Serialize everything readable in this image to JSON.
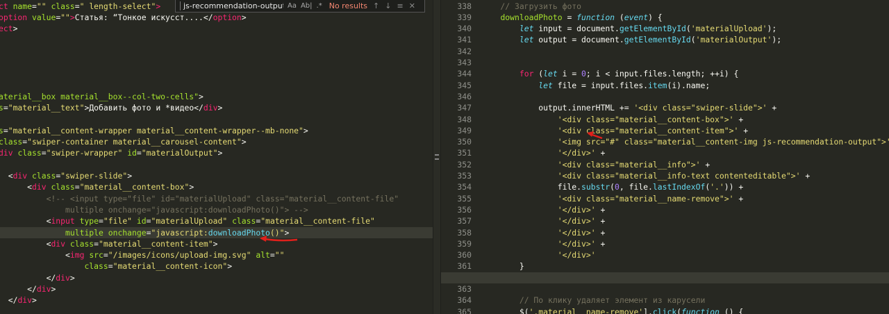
{
  "find_widget": {
    "query": "js-recommendation-output",
    "match_case": "Aa",
    "whole_word": "Ab|",
    "regex": ".*",
    "result": "No results",
    "prev": "↑",
    "next": "↓",
    "selection": "≡",
    "close": "✕"
  },
  "left_editor": {
    "lines": [
      [
        [
          "t",
          "ct "
        ],
        [
          "a",
          "name"
        ],
        [
          "w",
          "="
        ],
        [
          "s",
          "\"\""
        ],
        [
          "w",
          " "
        ],
        [
          "a",
          "class"
        ],
        [
          "w",
          "="
        ],
        [
          "s",
          "\" length-select\""
        ],
        [
          "t",
          ">"
        ]
      ],
      [
        [
          "t",
          "option "
        ],
        [
          "a",
          "value"
        ],
        [
          "w",
          "="
        ],
        [
          "s",
          "\"\""
        ],
        [
          "t",
          ">"
        ],
        [
          "w",
          "Статья: “Тонкое искусст....</"
        ],
        [
          "t",
          "option"
        ],
        [
          "w",
          ">"
        ]
      ],
      [
        [
          "t",
          "ect"
        ],
        [
          "w",
          ">"
        ]
      ],
      [],
      [],
      [],
      [],
      [],
      [
        [
          "a",
          "aterial__box material__box--col-two-cells\""
        ],
        [
          "w",
          ">"
        ]
      ],
      [
        [
          "a",
          "s"
        ],
        [
          "w",
          "="
        ],
        [
          "s",
          "\"material__text\""
        ],
        [
          "w",
          ">Добавить фото и *видео</"
        ],
        [
          "t",
          "div"
        ],
        [
          "w",
          ">"
        ]
      ],
      [],
      [
        [
          "a",
          "s"
        ],
        [
          "w",
          "="
        ],
        [
          "s",
          "\"material__content-wrapper material__content-wrapper--mb-none\""
        ],
        [
          "w",
          ">"
        ]
      ],
      [
        [
          "a",
          "class"
        ],
        [
          "w",
          "="
        ],
        [
          "s",
          "\"swiper-container material__carousel-content\""
        ],
        [
          "w",
          ">"
        ]
      ],
      [
        [
          "t",
          "div "
        ],
        [
          "a",
          "class"
        ],
        [
          "w",
          "="
        ],
        [
          "s",
          "\"swiper-wrapper\""
        ],
        [
          "w",
          " "
        ],
        [
          "a",
          "id"
        ],
        [
          "w",
          "="
        ],
        [
          "s",
          "\"materialOutput\""
        ],
        [
          "w",
          ">"
        ]
      ],
      [],
      [
        [
          "w",
          "  <"
        ],
        [
          "t",
          "div "
        ],
        [
          "a",
          "class"
        ],
        [
          "w",
          "="
        ],
        [
          "s",
          "\"swiper-slide\""
        ],
        [
          "w",
          ">"
        ]
      ],
      [
        [
          "w",
          "      <"
        ],
        [
          "t",
          "div "
        ],
        [
          "a",
          "class"
        ],
        [
          "w",
          "="
        ],
        [
          "s",
          "\"material__content-box\""
        ],
        [
          "w",
          ">"
        ]
      ],
      [
        [
          "c",
          "          <!-- <input type=\"file\" id=\"materialUpload\" class=\"material__content-file\""
        ]
      ],
      [
        [
          "c",
          "              multiple onchange=\"javascript:downloadPhoto()\"> -->"
        ]
      ],
      [
        [
          "w",
          "          <"
        ],
        [
          "t",
          "input "
        ],
        [
          "a",
          "type"
        ],
        [
          "w",
          "="
        ],
        [
          "s",
          "\"file\""
        ],
        [
          "w",
          " "
        ],
        [
          "a",
          "id"
        ],
        [
          "w",
          "="
        ],
        [
          "s",
          "\"materialUpload\""
        ],
        [
          "w",
          " "
        ],
        [
          "a",
          "class"
        ],
        [
          "w",
          "="
        ],
        [
          "s",
          "\"material__content-file\""
        ]
      ],
      [
        [
          "w",
          "              "
        ],
        [
          "a",
          "multiple onchange"
        ],
        [
          "w",
          "="
        ],
        [
          "s",
          "\"javascript:"
        ],
        [
          "f",
          "downloadPhoto"
        ],
        [
          "s",
          "()\""
        ],
        [
          "w",
          ">"
        ]
      ],
      [
        [
          "w",
          "          <"
        ],
        [
          "t",
          "div "
        ],
        [
          "a",
          "class"
        ],
        [
          "w",
          "="
        ],
        [
          "s",
          "\"material__content-item\""
        ],
        [
          "w",
          ">"
        ]
      ],
      [
        [
          "w",
          "              <"
        ],
        [
          "t",
          "img "
        ],
        [
          "a",
          "src"
        ],
        [
          "w",
          "="
        ],
        [
          "s",
          "\"/images/icons/upload-img.svg\""
        ],
        [
          "w",
          " "
        ],
        [
          "a",
          "alt"
        ],
        [
          "w",
          "="
        ],
        [
          "s",
          "\"\""
        ]
      ],
      [
        [
          "w",
          "                  "
        ],
        [
          "a",
          "class"
        ],
        [
          "w",
          "="
        ],
        [
          "s",
          "\"material__content-icon\""
        ],
        [
          "w",
          ">"
        ]
      ],
      [
        [
          "w",
          "          </"
        ],
        [
          "t",
          "div"
        ],
        [
          "w",
          ">"
        ]
      ],
      [
        [
          "w",
          "      </"
        ],
        [
          "t",
          "div"
        ],
        [
          "w",
          ">"
        ]
      ],
      [
        [
          "w",
          "  </"
        ],
        [
          "t",
          "div"
        ],
        [
          "w",
          ">"
        ]
      ]
    ],
    "active_line": 20
  },
  "right_editor": {
    "line_numbers": [
      "338",
      "339",
      "340",
      "341",
      "342",
      "343",
      "344",
      "345",
      "346",
      "347",
      "348",
      "349",
      "350",
      "351",
      "352",
      "353",
      "354",
      "355",
      "356",
      "357",
      "358",
      "359",
      "360",
      "361",
      "362",
      "363",
      "364",
      "365"
    ],
    "lines": [
      [
        [
          "c",
          "    // Загрузить фото"
        ]
      ],
      [
        [
          "w",
          "    "
        ],
        [
          "a",
          "downloadPhoto"
        ],
        [
          "w",
          " = "
        ],
        [
          "k",
          "function"
        ],
        [
          "w",
          " ("
        ],
        [
          "k",
          "event"
        ],
        [
          "w",
          ") {"
        ]
      ],
      [
        [
          "w",
          "        "
        ],
        [
          "k",
          "let"
        ],
        [
          "w",
          " input = document."
        ],
        [
          "f",
          "getElementById"
        ],
        [
          "w",
          "("
        ],
        [
          "y",
          "'materialUpload'"
        ],
        [
          "w",
          ");"
        ]
      ],
      [
        [
          "w",
          "        "
        ],
        [
          "k",
          "let"
        ],
        [
          "w",
          " output = document."
        ],
        [
          "f",
          "getElementById"
        ],
        [
          "w",
          "("
        ],
        [
          "y",
          "'materialOutput'"
        ],
        [
          "w",
          ");"
        ]
      ],
      [],
      [],
      [
        [
          "w",
          "        "
        ],
        [
          "t",
          "for"
        ],
        [
          "w",
          " ("
        ],
        [
          "k",
          "let"
        ],
        [
          "w",
          " i = "
        ],
        [
          "n",
          "0"
        ],
        [
          "w",
          "; i < input.files.length; ++i) {"
        ]
      ],
      [
        [
          "w",
          "            "
        ],
        [
          "k",
          "let"
        ],
        [
          "w",
          " file = input.files."
        ],
        [
          "f",
          "item"
        ],
        [
          "w",
          "(i).name;"
        ]
      ],
      [],
      [
        [
          "w",
          "            output.innerHTML += "
        ],
        [
          "y",
          "'<div class=\"swiper-slide\">'"
        ],
        [
          "w",
          " +"
        ]
      ],
      [
        [
          "w",
          "                "
        ],
        [
          "y",
          "'<div class=\"material__content-box\">'"
        ],
        [
          "w",
          " +"
        ]
      ],
      [
        [
          "w",
          "                "
        ],
        [
          "y",
          "'<div class=\"material__content-item\">'"
        ],
        [
          "w",
          " +"
        ]
      ],
      [
        [
          "w",
          "                "
        ],
        [
          "y",
          "'<img src=\"#\" class=\"material__content-img js-recommendation-output\">'"
        ],
        [
          "w",
          " +"
        ]
      ],
      [
        [
          "w",
          "                "
        ],
        [
          "y",
          "'</div>'"
        ],
        [
          "w",
          " +"
        ]
      ],
      [
        [
          "w",
          "                "
        ],
        [
          "y",
          "'<div class=\"material__info\">'"
        ],
        [
          "w",
          " +"
        ]
      ],
      [
        [
          "w",
          "                "
        ],
        [
          "y",
          "'<div class=\"material__info-text contenteditable\">'"
        ],
        [
          "w",
          " +"
        ]
      ],
      [
        [
          "w",
          "                file."
        ],
        [
          "f",
          "substr"
        ],
        [
          "w",
          "("
        ],
        [
          "n",
          "0"
        ],
        [
          "w",
          ", file."
        ],
        [
          "f",
          "lastIndexOf"
        ],
        [
          "w",
          "("
        ],
        [
          "y",
          "'.'"
        ],
        [
          "w",
          ")) +"
        ]
      ],
      [
        [
          "w",
          "                "
        ],
        [
          "y",
          "'<div class=\"material__name-remove\">'"
        ],
        [
          "w",
          " +"
        ]
      ],
      [
        [
          "w",
          "                "
        ],
        [
          "y",
          "'</div>'"
        ],
        [
          "w",
          " +"
        ]
      ],
      [
        [
          "w",
          "                "
        ],
        [
          "y",
          "'</div>'"
        ],
        [
          "w",
          " +"
        ]
      ],
      [
        [
          "w",
          "                "
        ],
        [
          "y",
          "'</div>'"
        ],
        [
          "w",
          " +"
        ]
      ],
      [
        [
          "w",
          "                "
        ],
        [
          "y",
          "'</div>'"
        ],
        [
          "w",
          " +"
        ]
      ],
      [
        [
          "w",
          "                "
        ],
        [
          "y",
          "'</div>'"
        ]
      ],
      [
        [
          "w",
          "        }"
        ]
      ],
      [],
      [],
      [
        [
          "c",
          "        // По клику удаляет элемент из карусели"
        ]
      ],
      [
        [
          "w",
          "        $("
        ],
        [
          "y",
          "'.material__name-remove'"
        ],
        [
          "w",
          "]."
        ],
        [
          "f",
          "click"
        ],
        [
          "w",
          "("
        ],
        [
          "k",
          "function"
        ],
        [
          "w",
          " () {"
        ]
      ]
    ],
    "active_line": 24
  },
  "annotations": {
    "arrow_color": "#e0201b"
  }
}
